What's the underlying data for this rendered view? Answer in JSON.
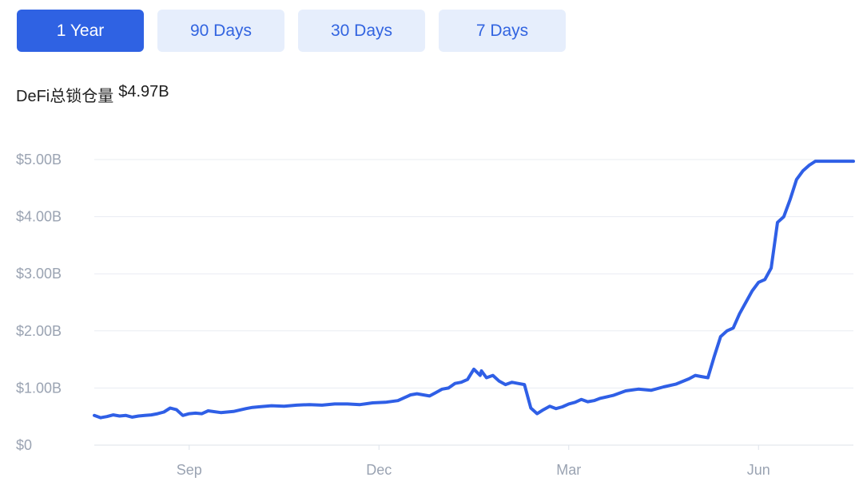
{
  "tabs": [
    {
      "label": "1 Year",
      "active": true
    },
    {
      "label": "90 Days",
      "active": false
    },
    {
      "label": "30 Days",
      "active": false
    },
    {
      "label": "7 Days",
      "active": false
    }
  ],
  "header": {
    "label": "DeFi总锁仓量",
    "value": "$4.97B"
  },
  "colors": {
    "accent": "#2f62e3",
    "tab_bg": "#e6eefc",
    "line": "#2f5fe6",
    "grid": "#e8ecf2",
    "tick": "#9aa3b2"
  },
  "chart_data": {
    "type": "line",
    "title": "",
    "xlabel": "",
    "ylabel": "",
    "ylim": [
      0,
      5.0
    ],
    "y_ticks": [
      {
        "value": 0,
        "label": "$0"
      },
      {
        "value": 1,
        "label": "$1.00B"
      },
      {
        "value": 2,
        "label": "$2.00B"
      },
      {
        "value": 3,
        "label": "$3.00B"
      },
      {
        "value": 4,
        "label": "$4.00B"
      },
      {
        "value": 5,
        "label": "$5.00B"
      }
    ],
    "x_ticks": [
      {
        "t": 0.15,
        "label": "Sep"
      },
      {
        "t": 0.45,
        "label": "Dec"
      },
      {
        "t": 0.75,
        "label": "Mar"
      },
      {
        "t": 1.05,
        "label": "Jun"
      }
    ],
    "grid": true,
    "series": [
      {
        "x": [
          0.0,
          0.01,
          0.02,
          0.03,
          0.04,
          0.05,
          0.06,
          0.07,
          0.08,
          0.09,
          0.1,
          0.11,
          0.12,
          0.13,
          0.14,
          0.15,
          0.16,
          0.17,
          0.18,
          0.2,
          0.22,
          0.24,
          0.25,
          0.26,
          0.28,
          0.3,
          0.32,
          0.34,
          0.36,
          0.38,
          0.4,
          0.42,
          0.44,
          0.46,
          0.48,
          0.5,
          0.51,
          0.52,
          0.53,
          0.54,
          0.55,
          0.56,
          0.57,
          0.58,
          0.59,
          0.6,
          0.61,
          0.612,
          0.62,
          0.63,
          0.64,
          0.65,
          0.66,
          0.67,
          0.68,
          0.69,
          0.7,
          0.71,
          0.72,
          0.73,
          0.74,
          0.75,
          0.76,
          0.77,
          0.78,
          0.79,
          0.8,
          0.82,
          0.84,
          0.86,
          0.88,
          0.9,
          0.92,
          0.94,
          0.95,
          0.96,
          0.97,
          0.98,
          0.99,
          1.0,
          1.01,
          1.02,
          1.03,
          1.04,
          1.05,
          1.06,
          1.07,
          1.08,
          1.09,
          1.1,
          1.11,
          1.12,
          1.13,
          1.14,
          1.15,
          1.16,
          1.17,
          1.18,
          1.19,
          1.2
        ],
        "values": [
          0.52,
          0.48,
          0.5,
          0.53,
          0.51,
          0.52,
          0.49,
          0.51,
          0.52,
          0.53,
          0.55,
          0.58,
          0.65,
          0.62,
          0.52,
          0.55,
          0.56,
          0.55,
          0.6,
          0.57,
          0.59,
          0.64,
          0.66,
          0.67,
          0.69,
          0.68,
          0.7,
          0.71,
          0.7,
          0.72,
          0.72,
          0.71,
          0.74,
          0.75,
          0.78,
          0.88,
          0.9,
          0.88,
          0.86,
          0.92,
          0.98,
          1.0,
          1.08,
          1.1,
          1.15,
          1.33,
          1.22,
          1.3,
          1.18,
          1.22,
          1.12,
          1.06,
          1.1,
          1.08,
          1.06,
          0.65,
          0.55,
          0.62,
          0.68,
          0.64,
          0.67,
          0.72,
          0.75,
          0.8,
          0.76,
          0.78,
          0.82,
          0.87,
          0.95,
          0.98,
          0.96,
          1.02,
          1.07,
          1.16,
          1.22,
          1.2,
          1.18,
          1.55,
          1.9,
          2.0,
          2.05,
          2.3,
          2.5,
          2.7,
          2.85,
          2.9,
          3.1,
          3.9,
          4.0,
          4.3,
          4.65,
          4.8,
          4.9,
          4.97,
          4.97,
          4.97,
          4.97,
          4.97,
          4.97,
          4.97
        ]
      }
    ]
  }
}
